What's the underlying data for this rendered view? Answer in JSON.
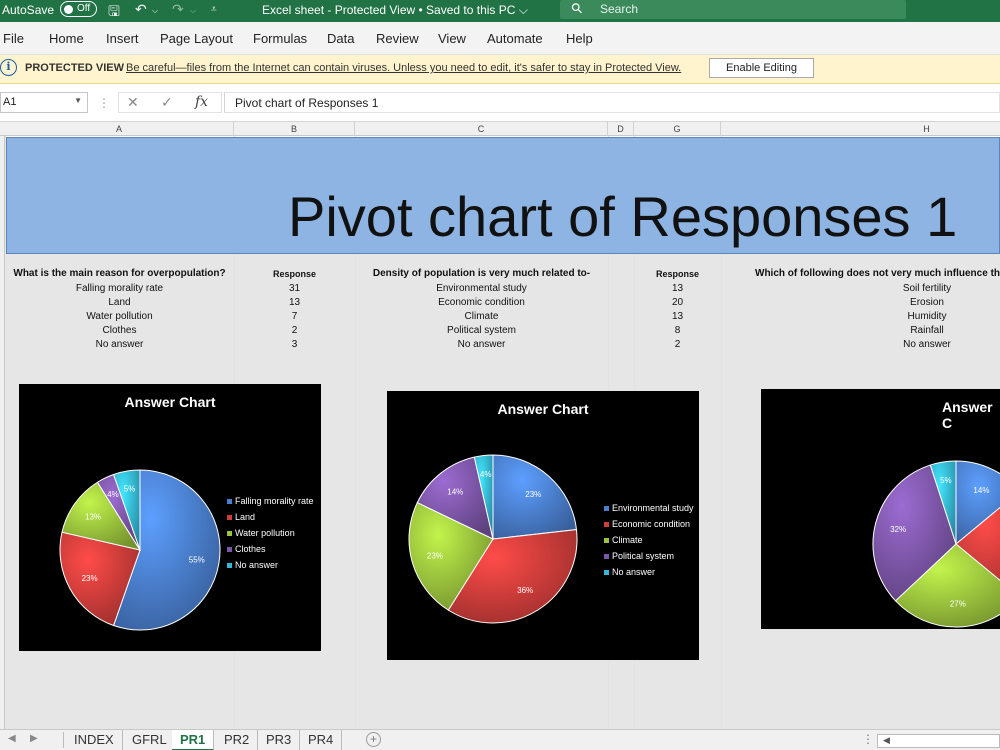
{
  "titlebar": {
    "autosave_label": "AutoSave",
    "autosave_state": "Off",
    "doc_title": "Excel sheet  -  Protected View • Saved to this PC ⌵",
    "search_placeholder": "Search"
  },
  "menu": [
    "File",
    "Home",
    "Insert",
    "Page Layout",
    "Formulas",
    "Data",
    "Review",
    "View",
    "Automate",
    "Help"
  ],
  "protected_view": {
    "label": "PROTECTED VIEW",
    "message": "Be careful—files from the Internet can contain viruses. Unless you need to edit, it's safer to stay in Protected View.",
    "button": "Enable Editing"
  },
  "formula_bar": {
    "name_box": "A1",
    "formula": "Pivot chart of Responses 1"
  },
  "columns": [
    "A",
    "B",
    "C",
    "D",
    "G",
    "H"
  ],
  "banner_title": "Pivot chart of Responses 1",
  "table1": {
    "question": "What is the main reason for overpopulation?",
    "response_header": "Response",
    "rows": [
      {
        "answer": "Falling morality rate",
        "response": "31"
      },
      {
        "answer": "Land",
        "response": "13"
      },
      {
        "answer": "Water pollution",
        "response": "7"
      },
      {
        "answer": "Clothes",
        "response": "2"
      },
      {
        "answer": "No answer",
        "response": "3"
      }
    ]
  },
  "table2": {
    "question": "Density of population is very much related to-",
    "response_header": "Response",
    "rows": [
      {
        "answer": "Environmental study",
        "response": "13"
      },
      {
        "answer": "Economic condition",
        "response": "20"
      },
      {
        "answer": "Climate",
        "response": "13"
      },
      {
        "answer": "Political system",
        "response": "8"
      },
      {
        "answer": "No answer",
        "response": "2"
      }
    ]
  },
  "table3": {
    "question": "Which of following does not very much influence the d",
    "rows": [
      {
        "answer": "Soil fertility"
      },
      {
        "answer": "Erosion"
      },
      {
        "answer": "Humidity"
      },
      {
        "answer": "Rainfall"
      },
      {
        "answer": "No answer"
      }
    ]
  },
  "colors": {
    "excel_green": "#217346",
    "banner_blue": "#8db4e2",
    "slice_blue": "#4a7fcf",
    "slice_red": "#cf3d3a",
    "slice_green": "#9bc33d",
    "slice_purple": "#7d56a8",
    "slice_cyan": "#35b8d8"
  },
  "chart_data": [
    {
      "type": "pie",
      "title": "Answer Chart",
      "categories": [
        "Falling morality rate",
        "Land",
        "Water pollution",
        "Clothes",
        "No answer"
      ],
      "values": [
        31,
        13,
        7,
        2,
        3
      ],
      "data_labels": [
        "55%",
        "23%",
        "13%",
        "4%",
        "5%"
      ],
      "legend": "right"
    },
    {
      "type": "pie",
      "title": "Answer Chart",
      "categories": [
        "Environmental study",
        "Economic condition",
        "Climate",
        "Political system",
        "No answer"
      ],
      "values": [
        13,
        20,
        13,
        8,
        2
      ],
      "data_labels": [
        "23%",
        "36%",
        "23%",
        "14%",
        "4%"
      ],
      "legend": "right"
    },
    {
      "type": "pie",
      "title": "Answer C",
      "categories": [
        "Soil fertility",
        "Erosion",
        "Humidity",
        "Rainfall",
        "No answer"
      ],
      "values": [
        14,
        22,
        27,
        32,
        5
      ],
      "data_labels": [
        "14%",
        "",
        "27%",
        "32%",
        "5%"
      ],
      "legend": "right"
    }
  ],
  "sheet_tabs": {
    "tabs": [
      "INDEX",
      "GFRL",
      "PR1",
      "PR2",
      "PR3",
      "PR4"
    ],
    "active": "PR1"
  }
}
